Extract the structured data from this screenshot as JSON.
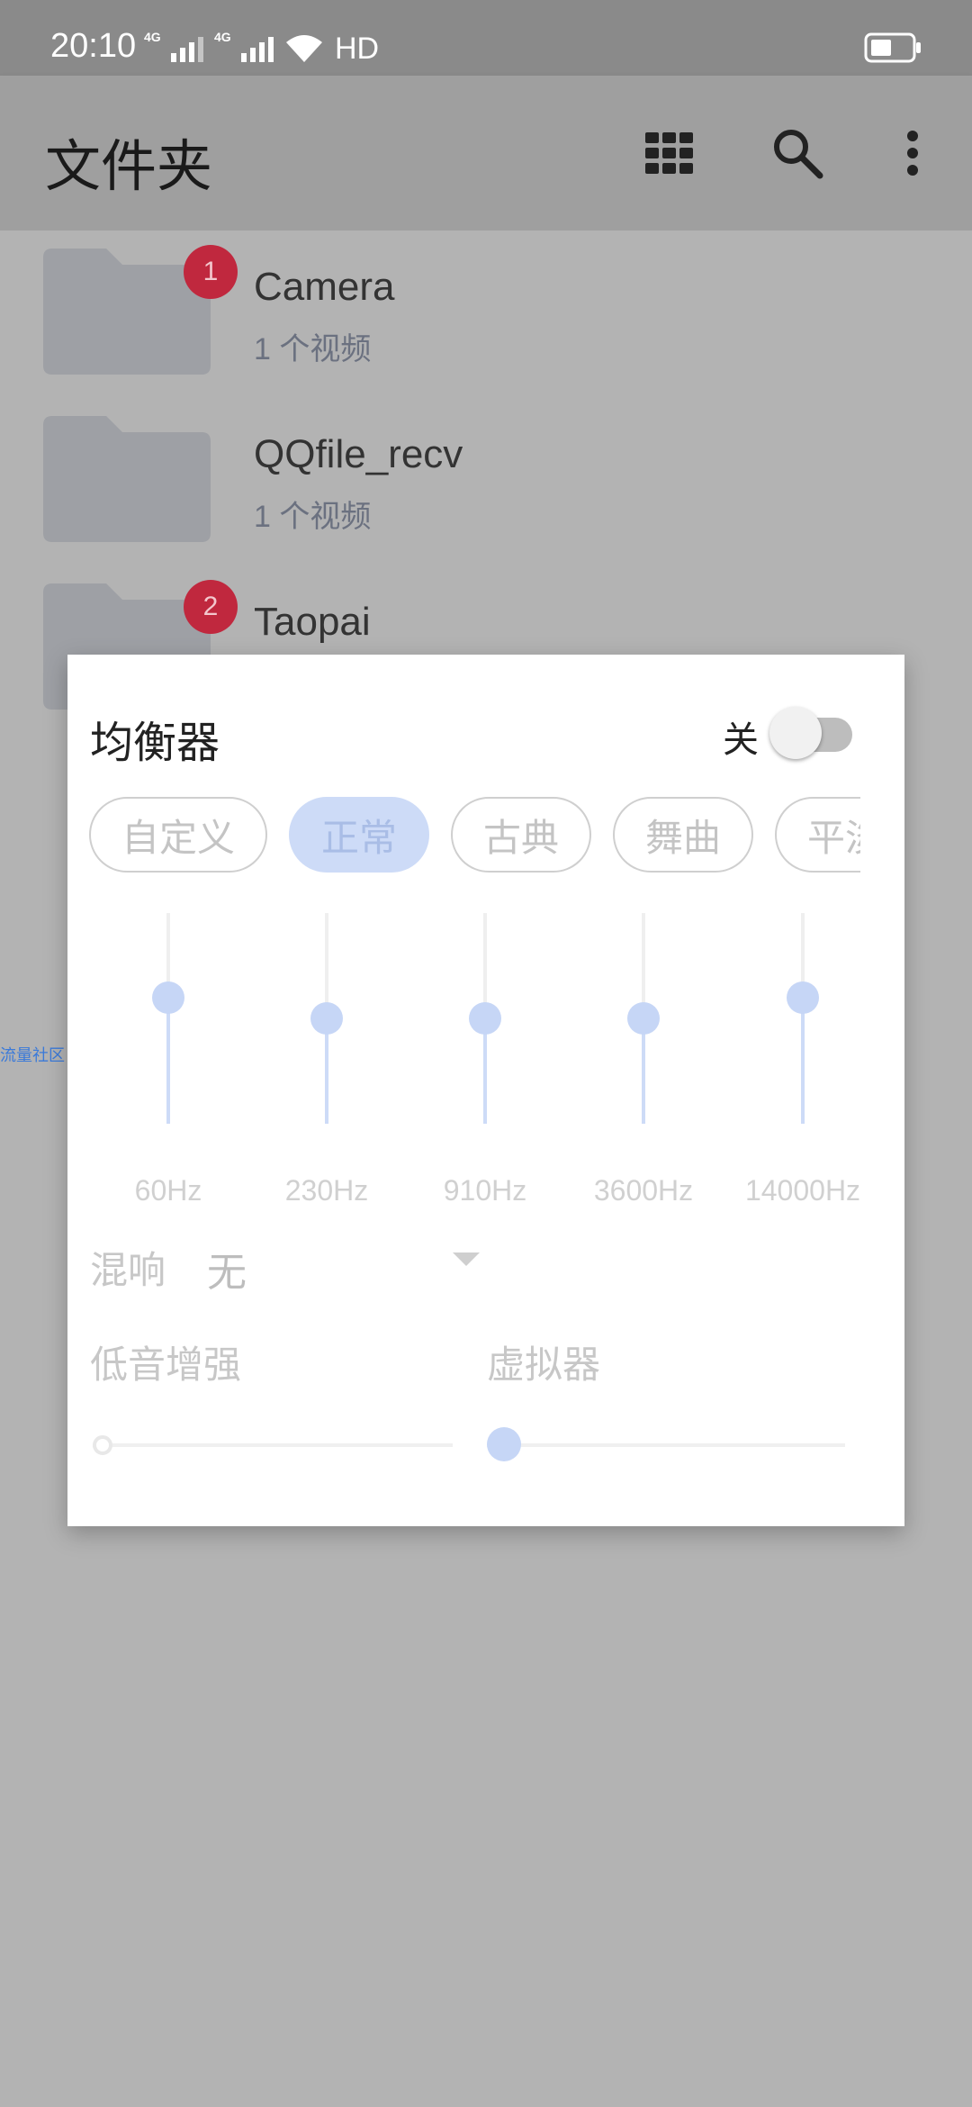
{
  "status_bar": {
    "time": "20:10",
    "network": [
      "4G",
      "4G"
    ],
    "hd_label": "HD",
    "battery_icon": "battery-half"
  },
  "app_bar": {
    "title": "文件夹",
    "icons": [
      "grid-view-icon",
      "search-icon",
      "more-vert-icon"
    ]
  },
  "folders": [
    {
      "name": "Camera",
      "subtitle": "1 个视频",
      "badge": "1"
    },
    {
      "name": "QQfile_recv",
      "subtitle": "1 个视频",
      "badge": ""
    },
    {
      "name": "Taopai",
      "subtitle": "",
      "badge": "2"
    }
  ],
  "watermark": "流量社区",
  "equalizer": {
    "title": "均衡器",
    "toggle_label": "关",
    "enabled": false,
    "presets": [
      "自定义",
      "正常",
      "古典",
      "舞曲",
      "平淡"
    ],
    "selected_preset": "正常",
    "bands": [
      {
        "freq": "60Hz",
        "level": 0.6
      },
      {
        "freq": "230Hz",
        "level": 0.5
      },
      {
        "freq": "910Hz",
        "level": 0.5
      },
      {
        "freq": "3600Hz",
        "level": 0.5
      },
      {
        "freq": "14000Hz",
        "level": 0.6
      }
    ],
    "reverb_label": "混响",
    "reverb_value": "无",
    "bass_boost_label": "低音增强",
    "bass_boost_level": 0,
    "virtualizer_label": "虚拟器",
    "virtualizer_level": 0
  },
  "colors": {
    "accent_light": "#cddbf7",
    "badge": "#c0283e",
    "scrim": "#b3b3b3"
  }
}
